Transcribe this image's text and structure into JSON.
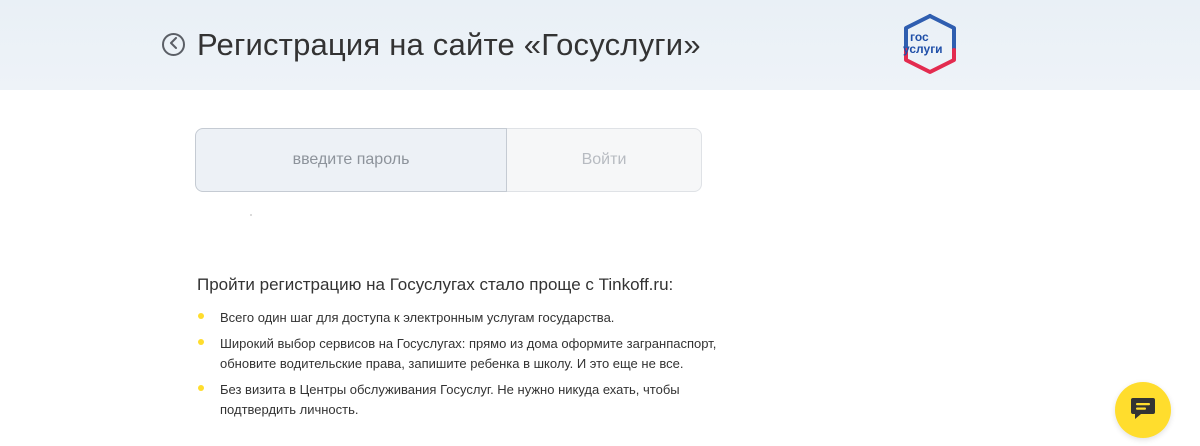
{
  "header": {
    "back_icon": "chevron-left-circle-icon",
    "title": "Регистрация на сайте «Госуслуги»",
    "logo": {
      "top_text": "гос",
      "bottom_text": "услуги",
      "colors": {
        "blue": "#2f5eb0",
        "red": "#e32b4f",
        "text": "#1f4fa8"
      }
    }
  },
  "form": {
    "password_placeholder": "введите пароль",
    "login_label": "Войти"
  },
  "info": {
    "title": "Пройти регистрацию на Госуслугах стало проще с Tinkoff.ru:",
    "bullets": [
      "Всего один шаг для доступа к электронным услугам государства.",
      "Широкий выбор сервисов на Госуслугах: прямо из дома оформите загранпаспорт, обновите водительские права, запишите ребенка в школу. И это еще не все.",
      "Без визита в Центры обслуживания Госуслуг. Не нужно никуда ехать, чтобы подтвердить личность."
    ],
    "bullet_color": "#ffdd2d"
  },
  "chat": {
    "icon": "chat-bubble-icon",
    "color": "#ffdd2d"
  }
}
